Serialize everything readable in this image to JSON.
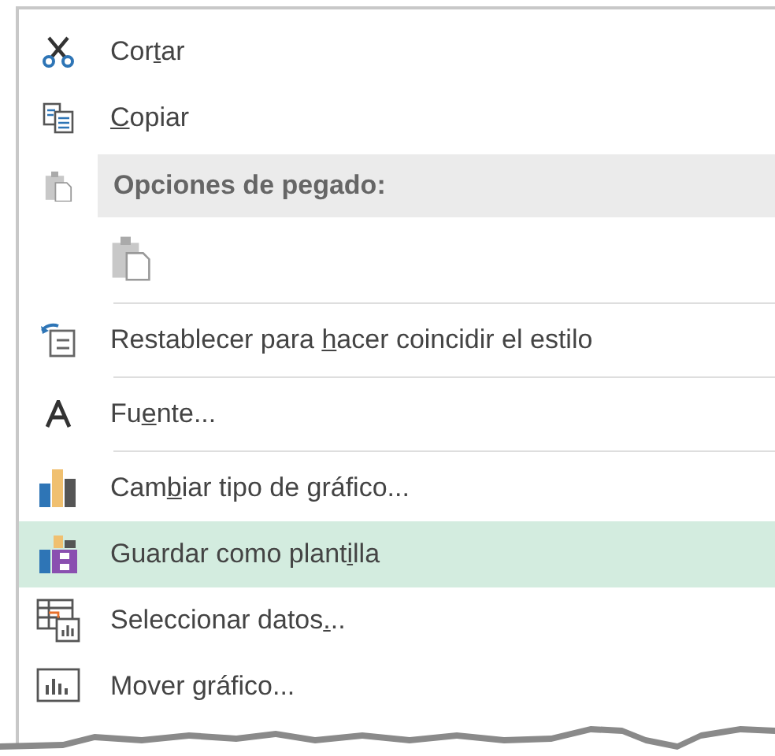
{
  "menu": {
    "items": [
      {
        "kind": "item",
        "label_before": "Cor",
        "access_key": "t",
        "label_after": "ar",
        "separator_after": false,
        "selected": false
      },
      {
        "kind": "item",
        "access_key": "C",
        "label_after": "opiar",
        "separator_after": false,
        "selected": false
      },
      {
        "kind": "header",
        "label": "Opciones de pegado:",
        "disabled": true
      },
      {
        "kind": "paste_options",
        "separator_after": true
      },
      {
        "kind": "item",
        "label_before": "Restablecer para ",
        "access_key": "h",
        "label_after": "acer coincidir el estilo",
        "separator_after": true,
        "selected": false
      },
      {
        "kind": "item",
        "label_before": "Fu",
        "access_key": "e",
        "label_after": "nte...",
        "separator_after": true,
        "selected": false
      },
      {
        "kind": "item",
        "label_before": "Cam",
        "access_key": "b",
        "label_after": "iar tipo de gráfico...",
        "separator_after": false,
        "selected": false
      },
      {
        "kind": "item",
        "label_before": "Guardar como plant",
        "access_key": "i",
        "label_after": "lla",
        "separator_after": false,
        "selected": true
      },
      {
        "kind": "item",
        "label_before": "Seleccionar datos",
        "access_key": ".",
        "label_after": "..",
        "separator_after": false,
        "selected": false
      },
      {
        "kind": "item",
        "label_before": "Mover gráfico...",
        "separator_after": false,
        "selected": false
      }
    ]
  }
}
